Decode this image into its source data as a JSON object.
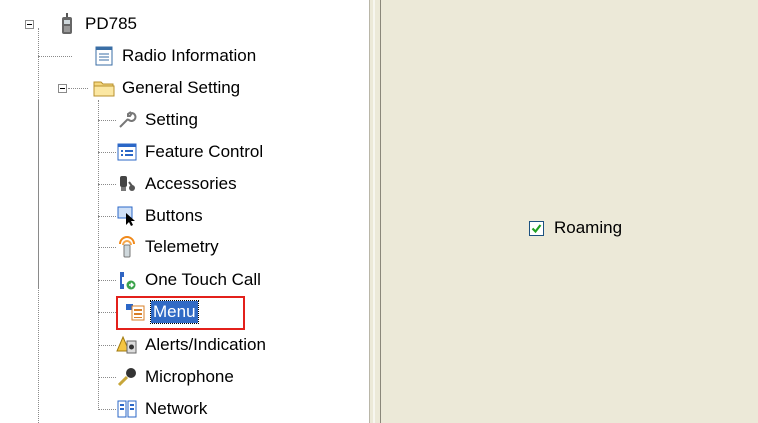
{
  "tree": {
    "root": {
      "label": "PD785",
      "icon": "radio-device-icon"
    },
    "items": [
      {
        "label": "Radio Information",
        "icon": "document-icon"
      },
      {
        "label": "General Setting",
        "icon": "folder-open-icon"
      }
    ],
    "general_setting_children": [
      {
        "label": "Setting",
        "icon": "wrench-icon"
      },
      {
        "label": "Feature Control",
        "icon": "list-window-icon"
      },
      {
        "label": "Accessories",
        "icon": "accessory-icon"
      },
      {
        "label": "Buttons",
        "icon": "cursor-button-icon"
      },
      {
        "label": "Telemetry",
        "icon": "telemetry-icon"
      },
      {
        "label": "One Touch Call",
        "icon": "phone-icon"
      },
      {
        "label": "Menu",
        "icon": "menu-icon",
        "selected": true
      },
      {
        "label": "Alerts/Indication",
        "icon": "alert-icon"
      },
      {
        "label": "Microphone",
        "icon": "microphone-icon"
      },
      {
        "label": "Network",
        "icon": "network-icon"
      }
    ]
  },
  "content": {
    "roaming": {
      "label": "Roaming",
      "checked": true
    }
  },
  "colors": {
    "selection_bg": "#316ac5",
    "highlight_border": "#e3201b",
    "panel_bg": "#ece9d8",
    "checkmark": "#21a121"
  }
}
